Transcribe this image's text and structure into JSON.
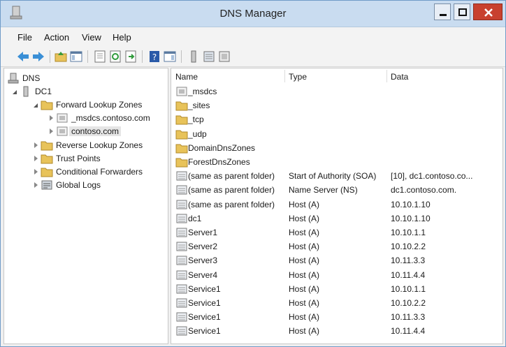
{
  "window": {
    "title": "DNS Manager"
  },
  "menu": {
    "file": "File",
    "action": "Action",
    "view": "View",
    "help": "Help"
  },
  "tree": {
    "root": "DNS",
    "server": "DC1",
    "forward": "Forward Lookup Zones",
    "msdcs_zone": "_msdcs.contoso.com",
    "contoso_zone": "contoso.com",
    "reverse": "Reverse Lookup Zones",
    "trust": "Trust Points",
    "conditional": "Conditional Forwarders",
    "global_logs": "Global Logs"
  },
  "list": {
    "columns": {
      "name": "Name",
      "type": "Type",
      "data": "Data"
    },
    "rows": [
      {
        "name": "_msdcs",
        "type": "",
        "data": "",
        "icon": "delegation-folder-icon"
      },
      {
        "name": "_sites",
        "type": "",
        "data": "",
        "icon": "folder-icon"
      },
      {
        "name": "_tcp",
        "type": "",
        "data": "",
        "icon": "folder-icon"
      },
      {
        "name": "_udp",
        "type": "",
        "data": "",
        "icon": "folder-icon"
      },
      {
        "name": "DomainDnsZones",
        "type": "",
        "data": "",
        "icon": "folder-icon"
      },
      {
        "name": "ForestDnsZones",
        "type": "",
        "data": "",
        "icon": "folder-icon"
      },
      {
        "name": "(same as parent folder)",
        "type": "Start of Authority (SOA)",
        "data": "[10], dc1.contoso.co...",
        "icon": "record-icon"
      },
      {
        "name": "(same as parent folder)",
        "type": "Name Server (NS)",
        "data": "dc1.contoso.com.",
        "icon": "record-icon"
      },
      {
        "name": "(same as parent folder)",
        "type": "Host (A)",
        "data": "10.10.1.10",
        "icon": "record-icon"
      },
      {
        "name": "dc1",
        "type": "Host (A)",
        "data": "10.10.1.10",
        "icon": "record-icon"
      },
      {
        "name": "Server1",
        "type": "Host (A)",
        "data": "10.10.1.1",
        "icon": "record-icon"
      },
      {
        "name": "Server2",
        "type": "Host (A)",
        "data": "10.10.2.2",
        "icon": "record-icon"
      },
      {
        "name": "Server3",
        "type": "Host (A)",
        "data": "10.11.3.3",
        "icon": "record-icon"
      },
      {
        "name": "Server4",
        "type": "Host (A)",
        "data": "10.11.4.4",
        "icon": "record-icon"
      },
      {
        "name": "Service1",
        "type": "Host (A)",
        "data": "10.10.1.1",
        "icon": "record-icon"
      },
      {
        "name": "Service1",
        "type": "Host (A)",
        "data": "10.10.2.2",
        "icon": "record-icon"
      },
      {
        "name": "Service1",
        "type": "Host (A)",
        "data": "10.11.3.3",
        "icon": "record-icon"
      },
      {
        "name": "Service1",
        "type": "Host (A)",
        "data": "10.11.4.4",
        "icon": "record-icon"
      }
    ]
  },
  "colors": {
    "folder": "#e8c35a",
    "titlebar": "#c9dcf0",
    "close": "#c8412f",
    "arrow": "#3a8fd6"
  }
}
